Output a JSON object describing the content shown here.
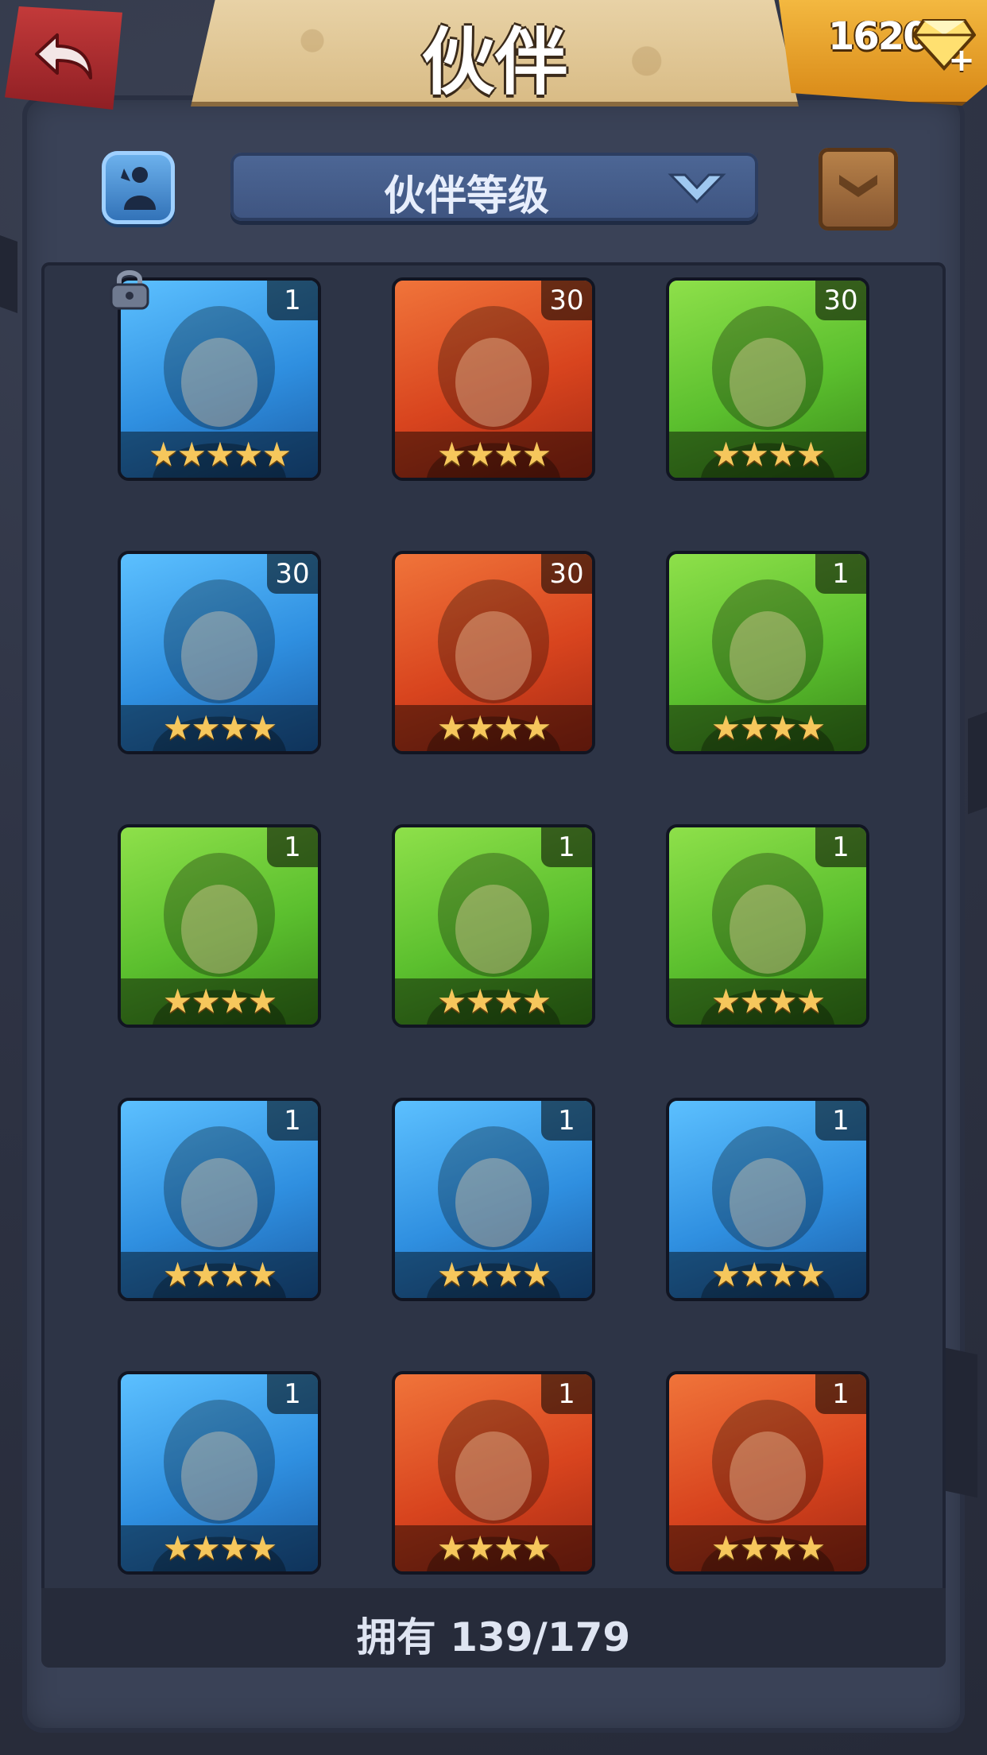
{
  "header": {
    "title": "伙伴"
  },
  "currency": {
    "gems": "16202"
  },
  "filter": {
    "selected": "伙伴等级"
  },
  "colors": {
    "red": "#e0552a",
    "green": "#5dc233",
    "blue": "#2f8fe0"
  },
  "heroes": [
    {
      "level": "1",
      "stars": "★★★★★",
      "color": "blue",
      "name": "white-hair-heroine"
    },
    {
      "level": "30",
      "stars": "★★★★",
      "color": "red",
      "name": "afro-red-headband"
    },
    {
      "level": "30",
      "stars": "★★★★",
      "color": "green",
      "name": "afro-green-headband"
    },
    {
      "level": "30",
      "stars": "★★★★",
      "color": "blue",
      "name": "blue-wolf"
    },
    {
      "level": "30",
      "stars": "★★★★",
      "color": "red",
      "name": "brown-hair-ranger"
    },
    {
      "level": "1",
      "stars": "★★★★",
      "color": "green",
      "name": "goblin"
    },
    {
      "level": "1",
      "stars": "★★★★",
      "color": "green",
      "name": "green-lizard-pink-flower"
    },
    {
      "level": "1",
      "stars": "★★★★",
      "color": "green",
      "name": "green-lizard-pink-flower-2"
    },
    {
      "level": "1",
      "stars": "★★★★",
      "color": "green",
      "name": "dark-hair-warrior"
    },
    {
      "level": "1",
      "stars": "★★★★",
      "color": "blue",
      "name": "blue-lizard"
    },
    {
      "level": "1",
      "stars": "★★★★",
      "color": "blue",
      "name": "scarecrow-witch"
    },
    {
      "level": "1",
      "stars": "★★★★",
      "color": "blue",
      "name": "blue-hair-woman"
    },
    {
      "level": "1",
      "stars": "★★★★",
      "color": "blue",
      "name": "dark-ponytail-woman"
    },
    {
      "level": "1",
      "stars": "★★★★",
      "color": "red",
      "name": "red-lizard"
    },
    {
      "level": "1",
      "stars": "★★★★",
      "color": "red",
      "name": "long-hair-man"
    }
  ],
  "footer": {
    "owned": "拥有 139/179"
  }
}
